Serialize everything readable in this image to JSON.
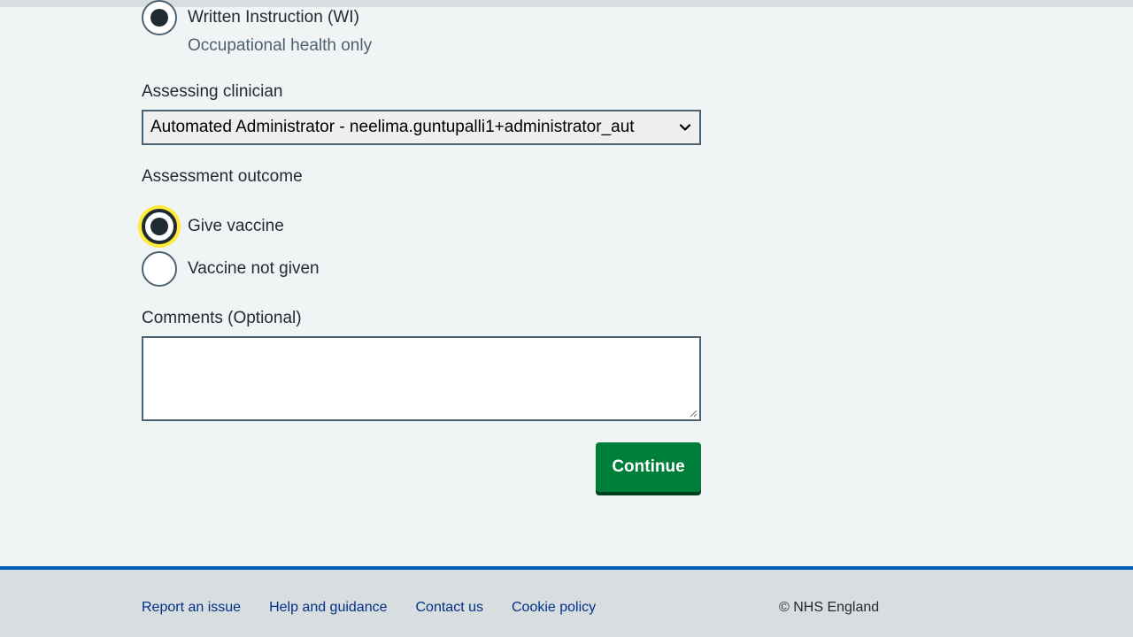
{
  "form": {
    "instruction_option": {
      "label": "Written Instruction (WI)",
      "hint": "Occupational health only",
      "selected": true
    },
    "clinician": {
      "label": "Assessing clinician",
      "selected_value": "Automated Administrator - neelima.guntupalli1+administrator_aut"
    },
    "outcome": {
      "label": "Assessment outcome",
      "options": [
        {
          "label": "Give vaccine",
          "selected": true
        },
        {
          "label": "Vaccine not given",
          "selected": false
        }
      ]
    },
    "comments": {
      "label": "Comments (Optional)",
      "value": ""
    },
    "continue_label": "Continue"
  },
  "footer": {
    "links": [
      {
        "label": "Report an issue"
      },
      {
        "label": "Help and guidance"
      },
      {
        "label": "Contact us"
      },
      {
        "label": "Cookie policy"
      }
    ],
    "copyright": "© NHS England"
  },
  "colors": {
    "background": "#f0f4f5",
    "text": "#212b32",
    "secondary_text": "#4c6272",
    "button": "#007f3b",
    "button_shadow": "#00401e",
    "focus": "#ffeb3b",
    "footer_bg": "#d8dde0",
    "footer_border": "#005eb8",
    "link": "#003087"
  }
}
